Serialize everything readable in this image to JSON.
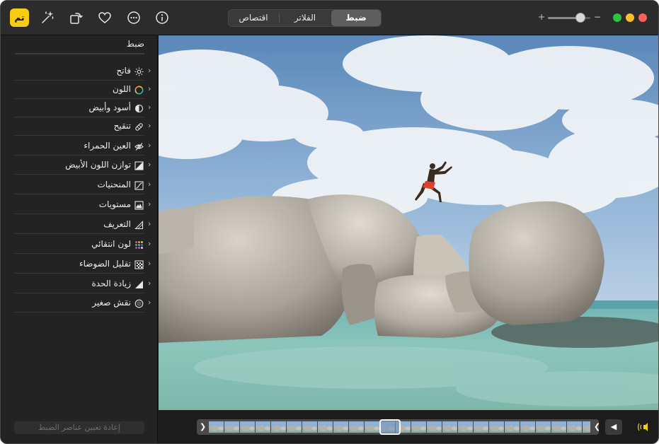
{
  "toolbar": {
    "done_label": "تم",
    "tabs": [
      {
        "label": "ضبط",
        "active": true
      },
      {
        "label": "الفلاتر",
        "active": false
      },
      {
        "label": "اقتصاص",
        "active": false
      }
    ],
    "zoom_plus": "+",
    "zoom_minus": "−",
    "zoom_level": 0.7,
    "icons": [
      "magic-wand-icon",
      "rotate-icon",
      "heart-icon",
      "more-options-icon",
      "info-icon"
    ],
    "traffic_lights": {
      "green": "#2ac640",
      "yellow": "#febc2e",
      "red": "#fe5f57"
    }
  },
  "sidebar": {
    "title": "ضبط",
    "items": [
      {
        "label": "فاتح",
        "icon": "sun-icon"
      },
      {
        "label": "اللون",
        "icon": "color-wheel-icon"
      },
      {
        "label": "أسود وأبيض",
        "icon": "half-circle-icon"
      },
      {
        "label": "تنقيح",
        "icon": "bandage-icon"
      },
      {
        "label": "العين الحمراء",
        "icon": "eye-slash-icon"
      },
      {
        "label": "توازن اللون الأبيض",
        "icon": "white-balance-icon"
      },
      {
        "label": "المنحنيات",
        "icon": "curves-icon"
      },
      {
        "label": "مستويات",
        "icon": "levels-icon"
      },
      {
        "label": "التعريف",
        "icon": "definition-icon"
      },
      {
        "label": "لون انتقائي",
        "icon": "selective-color-icon"
      },
      {
        "label": "تقليل الضوضاء",
        "icon": "noise-reduction-icon"
      },
      {
        "label": "زيادة الحدة",
        "icon": "sharpen-icon"
      },
      {
        "label": "نقش صغير",
        "icon": "vignette-icon"
      }
    ],
    "reset_label": "إعادة تعيين عناصر الضبط"
  },
  "bottom": {
    "left_arrow": "❮",
    "right_arrow": "❯",
    "play_symbol": "◀"
  },
  "colors": {
    "accent": "#f6cc14",
    "background": "#1e1e1e"
  }
}
